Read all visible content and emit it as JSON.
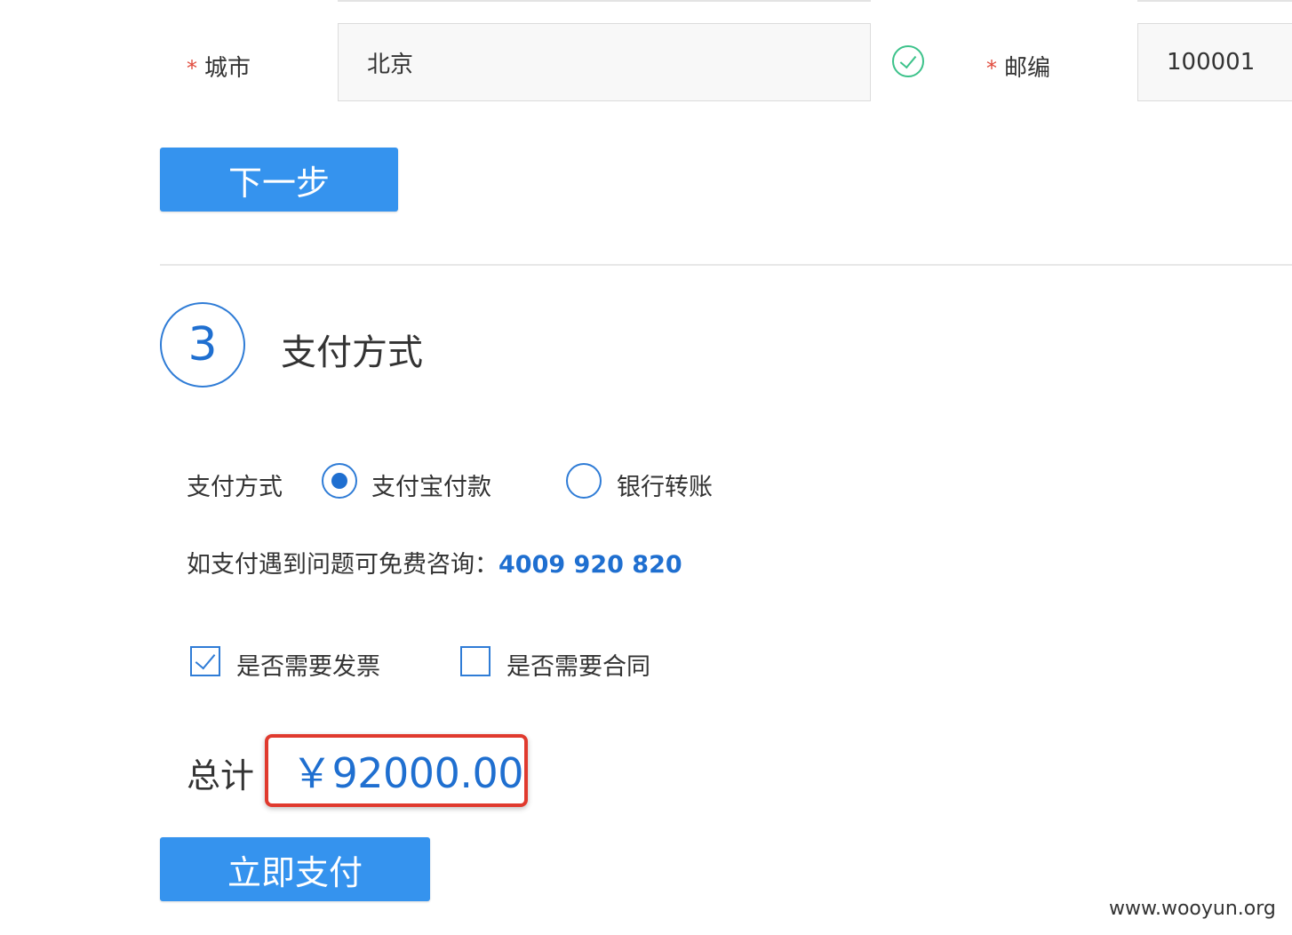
{
  "address": {
    "city_label": "城市",
    "city_value": "北京",
    "zip_label": "邮编",
    "zip_value": "100001",
    "required_mark": "*",
    "city_valid_icon": "check-circle-icon"
  },
  "buttons": {
    "next": "下一步",
    "pay_now": "立即支付"
  },
  "payment_section": {
    "step_number": "3",
    "title": "支付方式",
    "method_label": "支付方式",
    "options": [
      {
        "label": "支付宝付款",
        "selected": true
      },
      {
        "label": "银行转账",
        "selected": false
      }
    ],
    "help_text": "如支付遇到问题可免费咨询：",
    "help_phone": "4009 920 820",
    "checkboxes": [
      {
        "label": "是否需要发票",
        "checked": true
      },
      {
        "label": "是否需要合同",
        "checked": false
      }
    ],
    "total_label": "总计",
    "total_amount": "￥92000.00"
  },
  "watermark": "www.wooyun.org",
  "colors": {
    "primary": "#3593ee",
    "accent_blue": "#1f6fd0",
    "valid_green": "#3cc28a",
    "required_red": "#e04a3c",
    "highlight_red": "#e03a2e"
  }
}
